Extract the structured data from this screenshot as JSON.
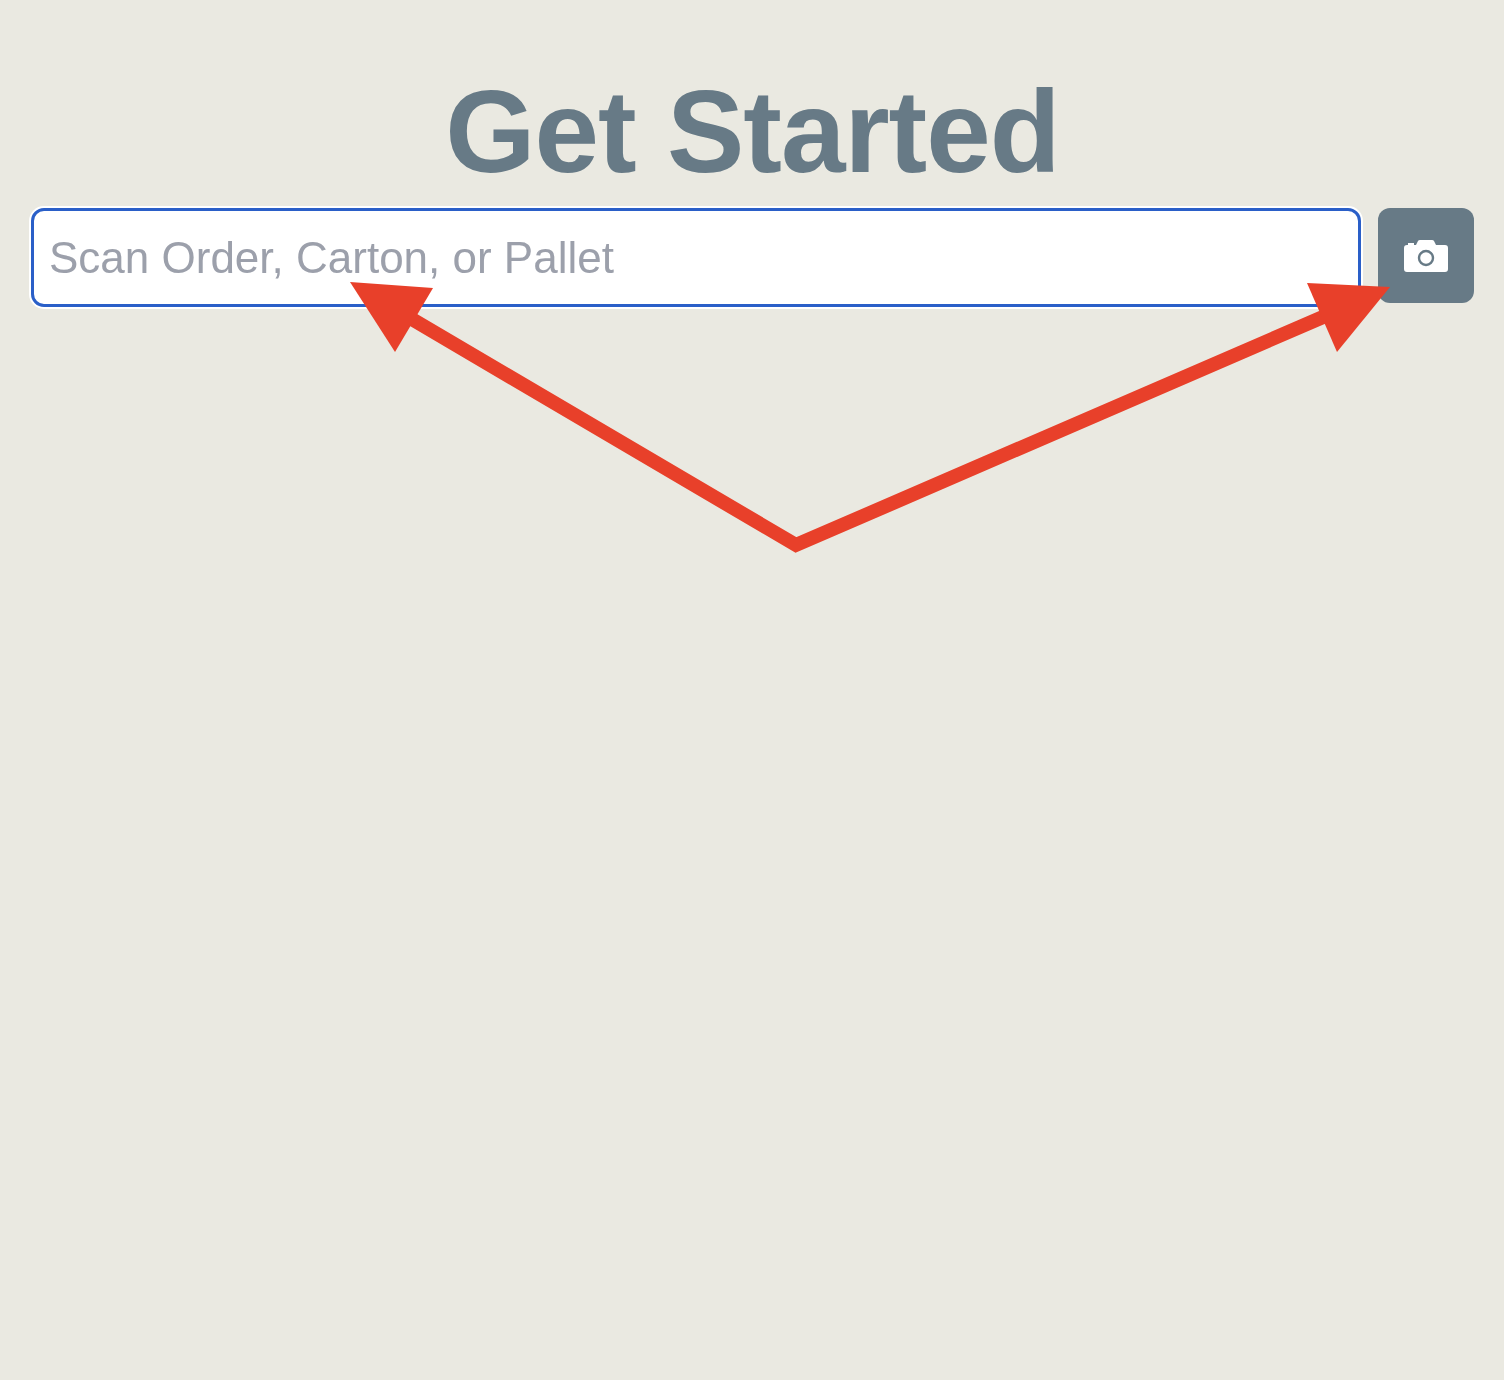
{
  "title": "Get Started",
  "scan_field": {
    "placeholder": "Scan Order, Carton, or Pallet",
    "focused": true
  }
}
